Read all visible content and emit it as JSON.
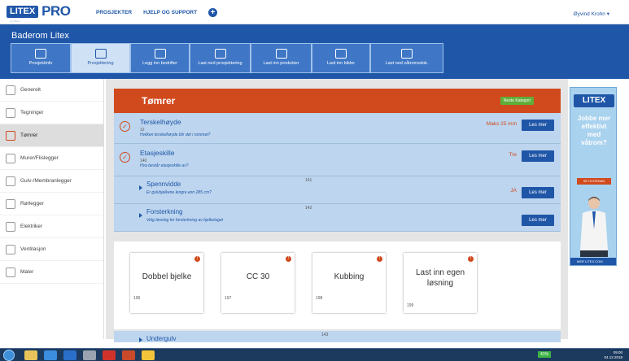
{
  "topbar": {
    "logo_brand": "LITEX",
    "logo_sub": "by Mapei",
    "logo_suffix": "PRO",
    "nav": [
      "PROSJEKTER",
      "HJELP OG SUPPORT"
    ],
    "user": "Øyvind Krohn"
  },
  "header": {
    "project_title": "Baderom Litex",
    "steps": [
      {
        "label": "Prosjektinfo"
      },
      {
        "label": "Prosjektering"
      },
      {
        "label": "Legg inn bedrifter"
      },
      {
        "label": "Last ned prosjektering"
      },
      {
        "label": "Last inn produkter"
      },
      {
        "label": "Last inn bilder"
      },
      {
        "label": "Last ned våtromsdok."
      }
    ]
  },
  "sidebar": {
    "items": [
      {
        "label": "Generelt"
      },
      {
        "label": "Tegninger"
      },
      {
        "label": "Tømrer"
      },
      {
        "label": "Murer/Flislegger"
      },
      {
        "label": "Gulv-/Membranlegger"
      },
      {
        "label": "Rørlegger"
      },
      {
        "label": "Elektriker"
      },
      {
        "label": "Ventilasjon"
      },
      {
        "label": "Maler"
      }
    ]
  },
  "category": {
    "title": "Tømrer",
    "next_button": "Neste Kategori"
  },
  "rows": [
    {
      "title": "Terskelhøyde",
      "num": "12",
      "desc": "Hvilken terskelhøyde blir det i rommet?",
      "value": "Maks 25 mm",
      "button": "Les mer"
    },
    {
      "title": "Etasjeskille",
      "num": "140",
      "desc": "Hva består etasjeskille av?",
      "value": "Tre",
      "button": "Les mer"
    }
  ],
  "subrows": [
    {
      "title": "Spennvidde",
      "num": "141",
      "desc": "Er gulvbjelkene lengre enn 285 cm?",
      "value": "JA",
      "button": "Les mer"
    },
    {
      "title": "Forsterkning",
      "num": "142",
      "desc": "Velg løsning for forsterkning av bjelkelaget",
      "value": "",
      "button": "Les mer"
    }
  ],
  "cards": [
    {
      "title": "Dobbel bjelke",
      "num": "196",
      "info": "!"
    },
    {
      "title": "CC 30",
      "num": "197",
      "info": "!"
    },
    {
      "title": "Kubbing",
      "num": "198",
      "info": "!"
    },
    {
      "title": "Last inn egen løsning",
      "num": "199",
      "info": "!"
    }
  ],
  "under": {
    "title": "Undergulv",
    "num": "143"
  },
  "ad": {
    "logo": "LITEX",
    "line1": "Jobbe mer",
    "line2": "effektivt",
    "line3": "med",
    "line4": "våtrom?",
    "button": "SE HVORDAN",
    "footer": "MER LITEX.COM"
  },
  "taskbar": {
    "battery": "41%",
    "time": "09:00",
    "date": "04.12.2018"
  },
  "colors": {
    "brand_blue": "#1f56a8",
    "accent_orange": "#d04a1e",
    "row_blue": "#bdd5ee",
    "green_button": "#5fae3a"
  }
}
